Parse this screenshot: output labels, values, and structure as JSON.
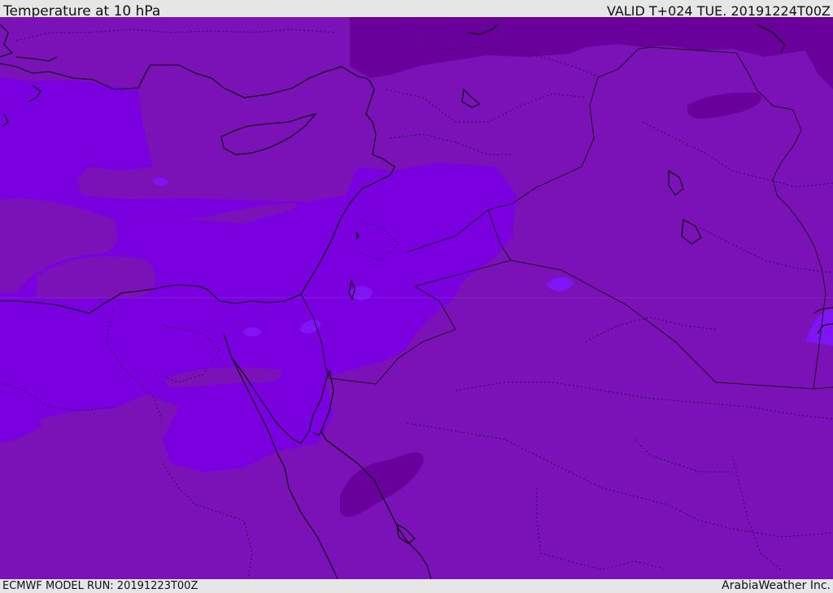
{
  "header": {
    "title": "Temperature at 10 hPa",
    "valid": "VALID T+024 TUE. 20191224T00Z"
  },
  "footer": {
    "model_run": "ECMWF MODEL RUN: 20191223T00Z",
    "credit": "ArabiaWeather Inc."
  },
  "colors": {
    "base_fill": "#7a12b8",
    "warm_band": "#7b00e0",
    "warmer_band": "#7f14f5",
    "cold_band": "#6a009c",
    "coastline": "#000000",
    "border_line": "#1a0030"
  }
}
